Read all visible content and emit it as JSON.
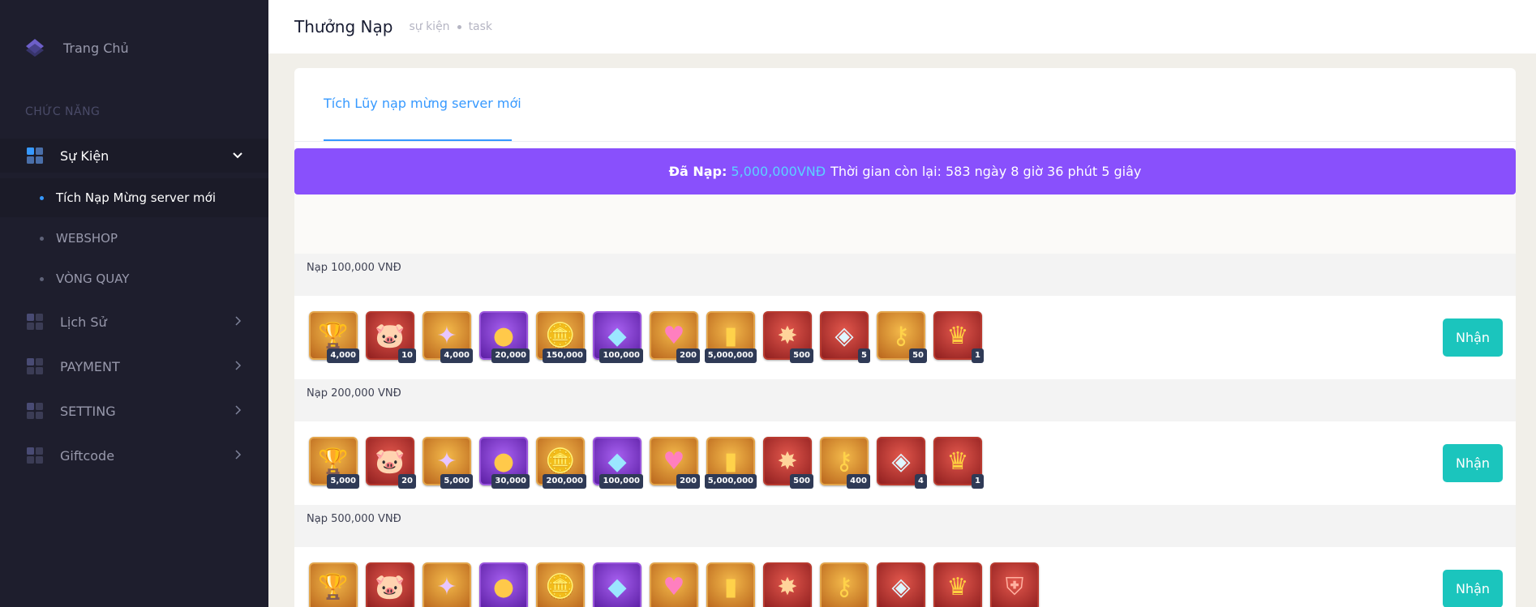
{
  "sidebar": {
    "brand": "Trang Chủ",
    "section_title": "CHỨC NĂNG",
    "menu": {
      "su_kien": "Sự Kiện",
      "lich_su": "Lịch Sử",
      "payment": "PAYMENT",
      "setting": "SETTING",
      "giftcode": "Giftcode"
    },
    "sub": {
      "tich_nap": "Tích Nạp Mừng server mới",
      "webshop": "WEBSHOP",
      "vong_quay": "VÒNG QUAY"
    }
  },
  "header": {
    "title": "Thưởng Nạp",
    "crumbs": [
      "sự kiện",
      "task"
    ]
  },
  "tab": "Tích Lũy nạp mừng server mới",
  "banner": {
    "label": "Đã Nạp:",
    "amount": "5,000,000VNĐ",
    "time_text": "Thời gian còn lại: 583 ngày 8 giờ 36 phút 5 giây"
  },
  "claim_label": "Nhận",
  "tiers": [
    {
      "title": "Nạp 100,000 VNĐ",
      "items": [
        {
          "icon": "gold-trophy-icon",
          "color": "orange",
          "qty": "4,000"
        },
        {
          "icon": "pink-pet-icon",
          "color": "red",
          "qty": "10"
        },
        {
          "icon": "purple-star-icon",
          "color": "orange",
          "qty": "4,000"
        },
        {
          "icon": "gold-orb-icon",
          "color": "purple",
          "qty": "20,000"
        },
        {
          "icon": "gold-coin-icon",
          "color": "orange",
          "qty": "150,000"
        },
        {
          "icon": "blue-crystal-icon",
          "color": "purple",
          "qty": "100,000"
        },
        {
          "icon": "heart-key-icon",
          "color": "orange",
          "qty": "200"
        },
        {
          "icon": "gold-bar-icon",
          "color": "orange",
          "qty": "5,000,000"
        },
        {
          "icon": "fire-burst-icon",
          "color": "red",
          "qty": "500"
        },
        {
          "icon": "diamond-icon",
          "color": "red",
          "qty": "5"
        },
        {
          "icon": "gold-key-icon",
          "color": "orange",
          "qty": "50"
        },
        {
          "icon": "crown-icon",
          "color": "red",
          "qty": "1"
        }
      ]
    },
    {
      "title": "Nạp 200,000 VNĐ",
      "items": [
        {
          "icon": "gold-trophy-icon",
          "color": "orange",
          "qty": "5,000"
        },
        {
          "icon": "pink-pet-icon",
          "color": "red",
          "qty": "20"
        },
        {
          "icon": "purple-star-icon",
          "color": "orange",
          "qty": "5,000"
        },
        {
          "icon": "gold-orb-icon",
          "color": "purple",
          "qty": "30,000"
        },
        {
          "icon": "gold-coin-icon",
          "color": "orange",
          "qty": "200,000"
        },
        {
          "icon": "blue-crystal-icon",
          "color": "purple",
          "qty": "100,000"
        },
        {
          "icon": "heart-key-icon",
          "color": "orange",
          "qty": "200"
        },
        {
          "icon": "gold-bar-icon",
          "color": "orange",
          "qty": "5,000,000"
        },
        {
          "icon": "fire-burst-icon",
          "color": "red",
          "qty": "500"
        },
        {
          "icon": "gold-key-icon",
          "color": "orange",
          "qty": "400"
        },
        {
          "icon": "diamond-icon",
          "color": "red",
          "qty": "4"
        },
        {
          "icon": "crown-icon",
          "color": "red",
          "qty": "1"
        }
      ]
    },
    {
      "title": "Nạp 500,000 VNĐ",
      "items": [
        {
          "icon": "gold-trophy-icon",
          "color": "orange",
          "qty": ""
        },
        {
          "icon": "pink-pet-icon",
          "color": "red",
          "qty": ""
        },
        {
          "icon": "purple-star-icon",
          "color": "orange",
          "qty": ""
        },
        {
          "icon": "gold-orb-icon",
          "color": "purple",
          "qty": ""
        },
        {
          "icon": "gold-coin-icon",
          "color": "orange",
          "qty": ""
        },
        {
          "icon": "blue-crystal-icon",
          "color": "purple",
          "qty": ""
        },
        {
          "icon": "heart-key-icon",
          "color": "orange",
          "qty": ""
        },
        {
          "icon": "gold-bar-icon",
          "color": "orange",
          "qty": ""
        },
        {
          "icon": "fire-burst-icon",
          "color": "red",
          "qty": ""
        },
        {
          "icon": "gold-key-icon",
          "color": "orange",
          "qty": ""
        },
        {
          "icon": "diamond-icon",
          "color": "red",
          "qty": ""
        },
        {
          "icon": "crown-icon",
          "color": "red",
          "qty": ""
        },
        {
          "icon": "red-shield-icon",
          "color": "red",
          "qty": ""
        }
      ]
    }
  ],
  "colors": {
    "sidebar_bg": "#1e1e2d",
    "accent": "#3699ff",
    "banner": "#8950fc",
    "amount": "#5bd2ff",
    "claim": "#1bc5bd"
  }
}
